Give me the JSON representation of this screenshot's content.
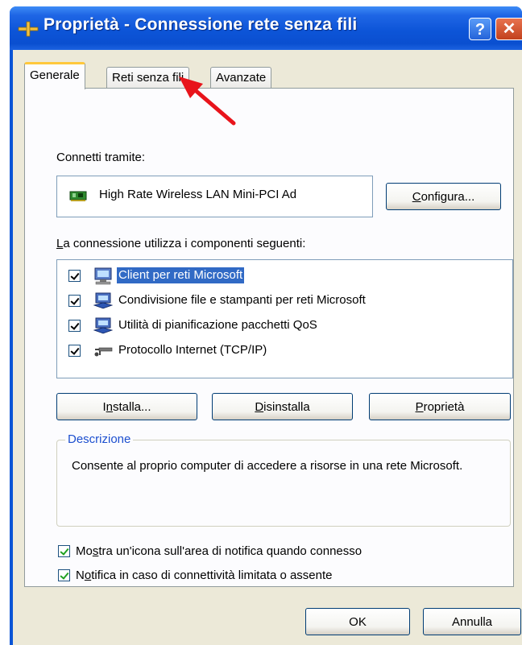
{
  "window": {
    "title": "Proprietà - Connessione rete senza fili",
    "help_label": "?",
    "close_label": "✕"
  },
  "tabs": [
    {
      "label": "Generale",
      "active": true
    },
    {
      "label": "Reti senza fili",
      "active": false
    },
    {
      "label": "Avanzate",
      "active": false
    }
  ],
  "general": {
    "connect_using_label": "Connetti tramite:",
    "adapter_name": "High Rate Wireless LAN Mini-PCI Ad",
    "configure_button": {
      "underline": "C",
      "rest": "onfigura..."
    },
    "components_label": {
      "underline": "L",
      "rest": "a connessione utilizza i componenti seguenti:"
    },
    "components": [
      {
        "label": "Client per reti Microsoft",
        "checked": true,
        "selected": true,
        "icon": "network-client-icon"
      },
      {
        "label": "Condivisione file e stampanti per reti Microsoft",
        "checked": true,
        "selected": false,
        "icon": "file-printer-sharing-icon"
      },
      {
        "label": "Utilità di pianificazione pacchetti QoS",
        "checked": true,
        "selected": false,
        "icon": "qos-scheduler-icon"
      },
      {
        "label": "Protocollo Internet (TCP/IP)",
        "checked": true,
        "selected": false,
        "icon": "network-protocol-icon"
      }
    ],
    "install_button": {
      "prefix": "I",
      "underline": "n",
      "rest": "stalla..."
    },
    "uninstall_button": {
      "underline": "D",
      "rest": "isinstalla"
    },
    "properties_button": {
      "underline": "P",
      "rest": "roprietà"
    },
    "description_title": "Descrizione",
    "description_text": "Consente al proprio computer di accedere a risorse in una rete Microsoft.",
    "show_icon_option": {
      "prefix": "Mo",
      "underline": "s",
      "rest": "tra un'icona sull'area di notifica quando connesso",
      "checked": true
    },
    "notify_option": {
      "prefix": "N",
      "underline": "o",
      "rest": "tifica in caso di connettività limitata o assente",
      "checked": true
    }
  },
  "footer": {
    "ok_label": "OK",
    "cancel_label": "Annulla"
  },
  "colors": {
    "titlebar": "#0a55d6",
    "selection": "#316ac5",
    "tab_highlight": "#ffc83c",
    "annotation_arrow": "#e8141b"
  }
}
